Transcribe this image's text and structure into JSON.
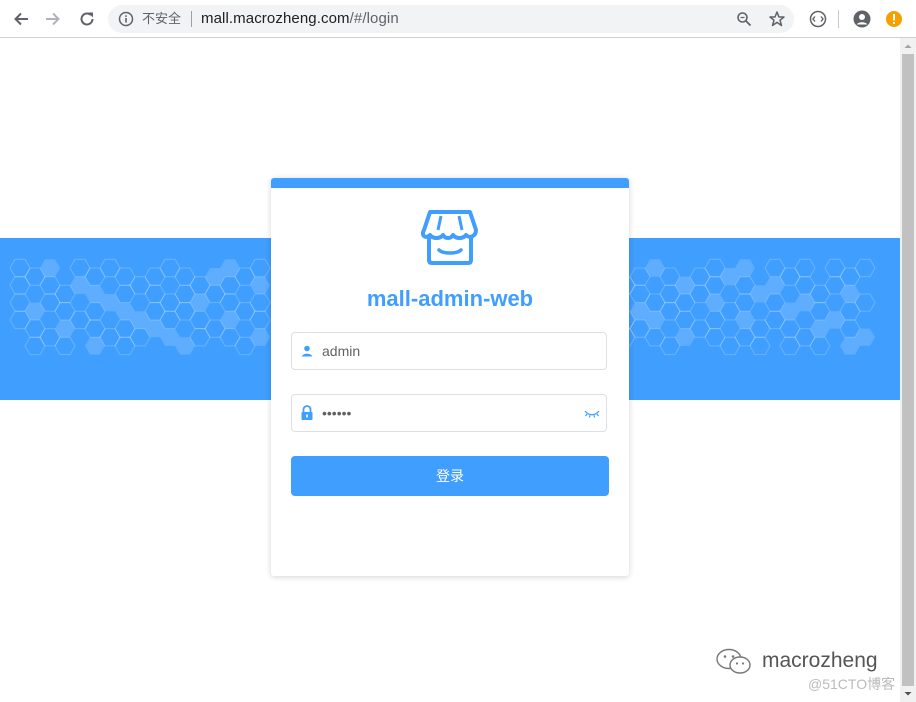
{
  "browser": {
    "security_label": "不安全",
    "url_host": "mall.macrozheng.com",
    "url_path": "/#/login"
  },
  "login": {
    "app_title": "mall-admin-web",
    "username_value": "admin",
    "password_value": "••••••",
    "submit_label": "登录"
  },
  "watermark": {
    "author": "macrozheng",
    "site": "@51CTO博客"
  },
  "colors": {
    "primary": "#409eff",
    "banner": "#409eff",
    "border": "#dcdfe6",
    "text": "#606266"
  },
  "icons": {
    "back": "arrow-left-icon",
    "forward": "arrow-right-icon",
    "reload": "reload-icon",
    "info": "info-icon",
    "zoom": "zoom-icon",
    "star": "star-icon",
    "extension": "extension-icon",
    "account": "account-icon",
    "update": "update-warning-icon",
    "user": "user-icon",
    "lock": "lock-icon",
    "eye": "eye-closed-icon",
    "logo": "shop-logo-icon"
  }
}
